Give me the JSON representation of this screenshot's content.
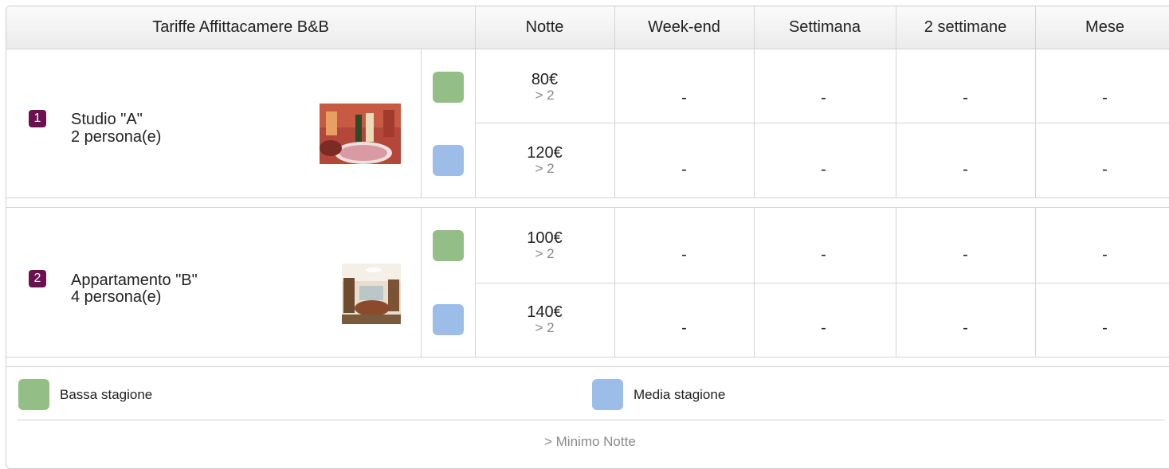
{
  "table": {
    "headers": [
      "Tariffe Affittacamere B&B",
      "Notte",
      "Week-end",
      "Settimana",
      "2 settimane",
      "Mese"
    ],
    "colors": {
      "bassa": "#93bf87",
      "media": "#9dbde9",
      "badge": "#6b1151"
    },
    "rooms": [
      {
        "number": "1",
        "name": "Studio \"A\"",
        "capacity": "2 persona(e)",
        "rates": [
          {
            "season": "bassa",
            "notte": "80€",
            "min": "> 2",
            "weekend": "-",
            "settimana": "-",
            "due_settimane": "-",
            "mese": "-"
          },
          {
            "season": "media",
            "notte": "120€",
            "min": "> 2",
            "weekend": "-",
            "settimana": "-",
            "due_settimane": "-",
            "mese": "-"
          }
        ]
      },
      {
        "number": "2",
        "name": "Appartamento \"B\"",
        "capacity": "4 persona(e)",
        "rates": [
          {
            "season": "bassa",
            "notte": "100€",
            "min": "> 2",
            "weekend": "-",
            "settimana": "-",
            "due_settimane": "-",
            "mese": "-"
          },
          {
            "season": "media",
            "notte": "140€",
            "min": "> 2",
            "weekend": "-",
            "settimana": "-",
            "due_settimane": "-",
            "mese": "-"
          }
        ]
      }
    ]
  },
  "legend": {
    "bassa": "Bassa stagione",
    "media": "Media stagione",
    "note": "> Minimo Notte"
  }
}
